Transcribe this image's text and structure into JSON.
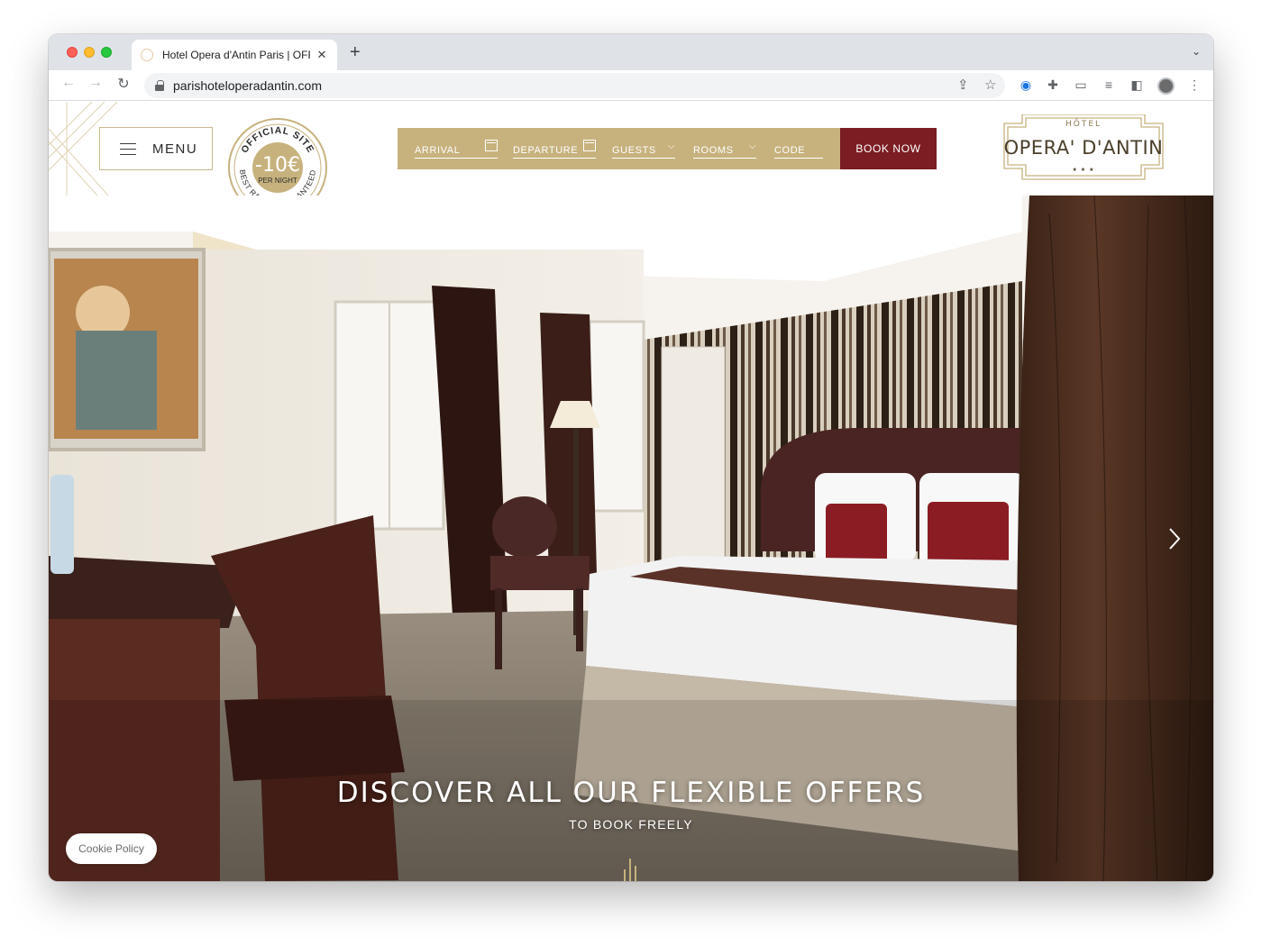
{
  "browser": {
    "tab_title": "Hotel Opera d'Antin Paris | OFF",
    "new_tab": "+",
    "url": "parishoteloperadantin.com"
  },
  "header": {
    "menu_label": "MENU",
    "badge": {
      "top_text": "OFFICIAL SITE",
      "discount": "-10€",
      "per_night": "PER NIGHT",
      "bottom_text": "BEST RATES GUARANTEED"
    },
    "booking": {
      "arrival": "ARRIVAL",
      "departure": "DEPARTURE",
      "guests": "GUESTS",
      "rooms": "ROOMS",
      "code": "CODE",
      "book_now": "BOOK NOW"
    },
    "logo": {
      "top": "HÔTEL",
      "name": "OPERA' D'ANTIN",
      "stars": "★ ★ ★"
    }
  },
  "hero": {
    "title": "DISCOVER ALL OUR FLEXIBLE OFFERS",
    "subtitle": "TO BOOK FREELY"
  },
  "cookie_label": "Cookie Policy",
  "colors": {
    "gold": "#c7b27e",
    "burgundy": "#7b1d22"
  }
}
